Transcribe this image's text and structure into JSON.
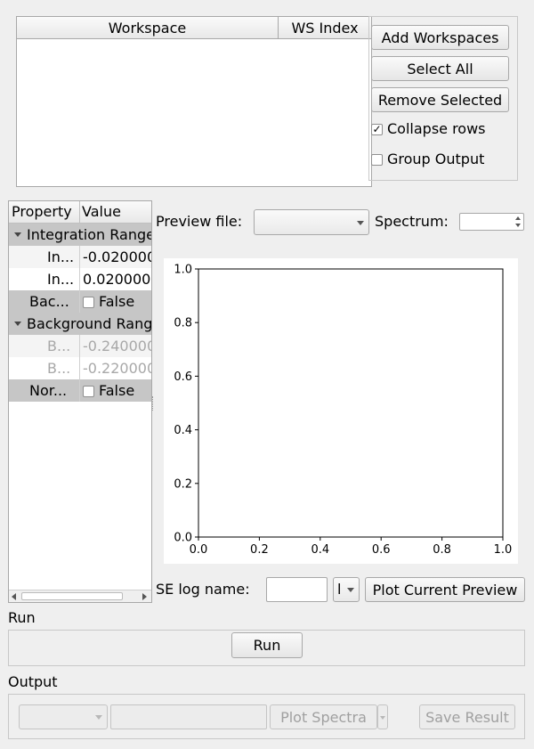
{
  "workspace_table": {
    "col_workspace": "Workspace",
    "col_ws_index": "WS Index"
  },
  "buttons": {
    "add_workspaces": "Add Workspaces",
    "select_all": "Select All",
    "remove_selected": "Remove Selected",
    "plot_current_preview": "Plot Current Preview",
    "run": "Run",
    "plot_spectra": "Plot Spectra",
    "save_result": "Save Result"
  },
  "options": {
    "collapse_rows": {
      "label": "Collapse rows",
      "checked": true
    },
    "group_output": {
      "label": "Group Output",
      "checked": false
    }
  },
  "property_tree": {
    "col_property": "Property",
    "col_value": "Value",
    "rows": [
      {
        "kind": "group",
        "property": "Integration Range"
      },
      {
        "kind": "item",
        "property": "Integration Range Start",
        "property_short": "In...",
        "value": "-0.020000"
      },
      {
        "kind": "item",
        "property": "Integration Range End",
        "property_short": "In...",
        "value": "0.020000"
      },
      {
        "kind": "bool",
        "property": "Background Subtraction",
        "property_short": "Bac...",
        "value": "False"
      },
      {
        "kind": "group",
        "property": "Background Range"
      },
      {
        "kind": "disabled",
        "property": "Background Range Start",
        "property_short": "B...",
        "value": "-0.240000"
      },
      {
        "kind": "disabled",
        "property": "Background Range End",
        "property_short": "B...",
        "value": "-0.220000"
      },
      {
        "kind": "bool",
        "property": "Normalise",
        "property_short": "Nor...",
        "value": "False"
      }
    ]
  },
  "preview": {
    "file_label": "Preview file:",
    "file_value": "",
    "spectrum_label": "Spectrum:",
    "spectrum_value": ""
  },
  "chart_data": {
    "type": "line",
    "series": [],
    "xlim": [
      0.0,
      1.0
    ],
    "ylim": [
      0.0,
      1.0
    ],
    "xticks": [
      "0.0",
      "0.2",
      "0.4",
      "0.6",
      "0.8",
      "1.0"
    ],
    "yticks": [
      "0.0",
      "0.2",
      "0.4",
      "0.6",
      "0.8",
      "1.0"
    ],
    "grid": false,
    "title": "",
    "xlabel": "",
    "ylabel": ""
  },
  "se_log": {
    "label": "SE log name:",
    "value": "",
    "function_value": "l"
  },
  "run_section": {
    "title": "Run"
  },
  "output_section": {
    "title": "Output",
    "workspace_value": "",
    "text_value": ""
  }
}
